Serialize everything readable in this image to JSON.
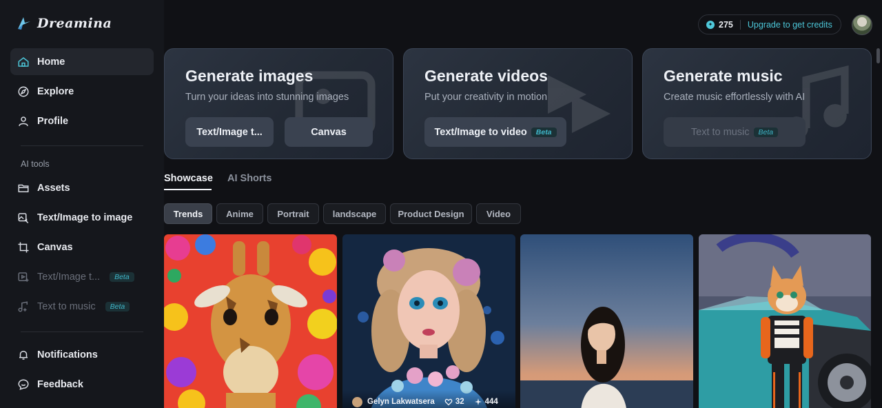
{
  "brand": {
    "name": "Dreamina"
  },
  "sidebar": {
    "items": [
      {
        "label": "Home",
        "icon": "home-icon"
      },
      {
        "label": "Explore",
        "icon": "compass-icon"
      },
      {
        "label": "Profile",
        "icon": "user-icon"
      }
    ],
    "section_label": "AI tools",
    "tools": [
      {
        "label": "Assets",
        "icon": "folder-icon"
      },
      {
        "label": "Text/Image to image",
        "icon": "image-edit-icon"
      },
      {
        "label": "Canvas",
        "icon": "crop-icon"
      },
      {
        "label": "Text/Image t...",
        "icon": "video-icon",
        "badge": "Beta"
      },
      {
        "label": "Text to music",
        "icon": "music-note-icon",
        "badge": "Beta"
      }
    ],
    "footer": [
      {
        "label": "Notifications",
        "icon": "bell-icon"
      },
      {
        "label": "Feedback",
        "icon": "feedback-icon"
      }
    ]
  },
  "header": {
    "credits": "275",
    "upgrade_label": "Upgrade to get credits"
  },
  "cards": [
    {
      "title": "Generate images",
      "subtitle": "Turn your ideas into stunning images",
      "buttons": [
        "Text/Image t...",
        "Canvas"
      ]
    },
    {
      "title": "Generate videos",
      "subtitle": "Put your creativity in motion",
      "buttons": [
        "Text/Image to video"
      ],
      "badge": "Beta"
    },
    {
      "title": "Generate music",
      "subtitle": "Create music effortlessly with AI",
      "buttons": [
        "Text to music"
      ],
      "badge": "Beta"
    }
  ],
  "tabs": [
    "Showcase",
    "AI Shorts"
  ],
  "filters": [
    "Trends",
    "Anime",
    "Portrait",
    "landscape",
    "Product Design",
    "Video"
  ],
  "gallery": [
    {
      "subject": "giraffe with flowers"
    },
    {
      "subject": "doll portrait",
      "author": "Gelyn Lakwatsera",
      "likes": "32",
      "uses": "444"
    },
    {
      "subject": "woman at beach sunset"
    },
    {
      "subject": "cat by sports car"
    }
  ],
  "colors": {
    "accent": "#4cc6d8",
    "background": "#101115",
    "sidebar": "#15171c"
  }
}
